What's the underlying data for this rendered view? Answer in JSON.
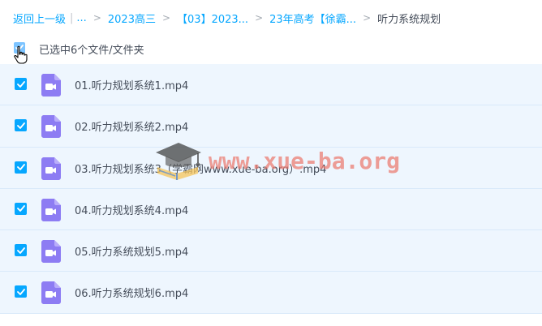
{
  "breadcrumb": {
    "back_label": "返回上一级",
    "bar": "|",
    "ellipsis": "...",
    "separator": ">",
    "items": [
      "2023高三",
      "【03】2023...",
      "23年高考【徐霸..."
    ],
    "current": "听力系统规划"
  },
  "selection": {
    "status_text": "已选中6个文件/文件夹",
    "all_checked": true
  },
  "files": [
    {
      "name": "01.听力规划系统1.mp4",
      "checked": true,
      "icon": "video-file-icon"
    },
    {
      "name": "02.听力规划系统2.mp4",
      "checked": true,
      "icon": "video-file-icon"
    },
    {
      "name": "03.听力规划系统3（学霸网www.xue-ba.org）.mp4",
      "checked": true,
      "icon": "video-file-icon"
    },
    {
      "name": "04.听力规划系统4.mp4",
      "checked": true,
      "icon": "video-file-icon"
    },
    {
      "name": "05.听力系统规划5.mp4",
      "checked": true,
      "icon": "video-file-icon"
    },
    {
      "name": "06.听力系统规划6.mp4",
      "checked": true,
      "icon": "video-file-icon"
    }
  ],
  "watermark": {
    "text": "www.xue-ba.org",
    "logo_icon": "graduation-cap-icon"
  },
  "colors": {
    "accent": "#06a7ff",
    "row_bg": "#eef6fe",
    "video_icon": "#8d7cf3",
    "text": "#454d5a"
  }
}
